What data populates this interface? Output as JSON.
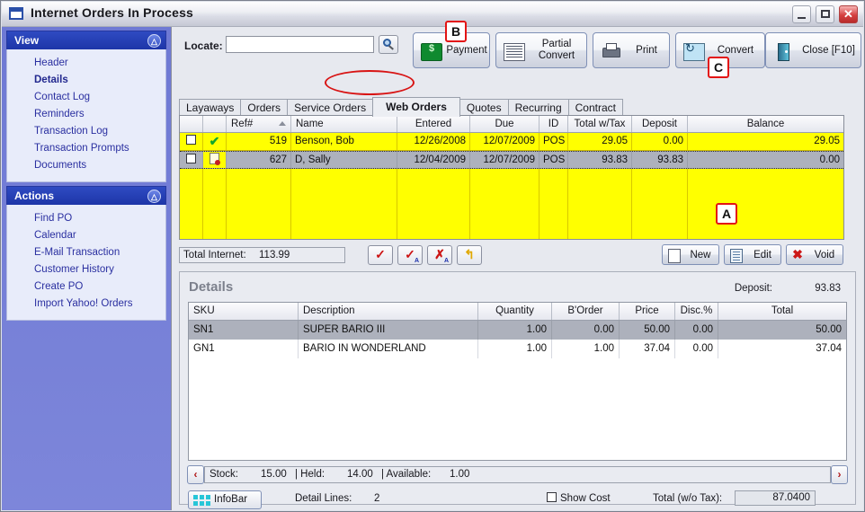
{
  "window": {
    "title": "Internet Orders In Process",
    "icon": "window-icon",
    "controls": {
      "minimize": "minimize-button",
      "maximize": "maximize-button",
      "close": "close-button"
    }
  },
  "sidebar": {
    "panels": [
      {
        "title": "View",
        "items": [
          {
            "label": "Header",
            "active": false
          },
          {
            "label": "Details",
            "active": true
          },
          {
            "label": "Contact Log",
            "active": false
          },
          {
            "label": "Reminders",
            "active": false
          },
          {
            "label": "Transaction Log",
            "active": false
          },
          {
            "label": "Transaction Prompts",
            "active": false
          },
          {
            "label": "Documents",
            "active": false
          }
        ]
      },
      {
        "title": "Actions",
        "items": [
          {
            "label": "Find PO",
            "active": false
          },
          {
            "label": "Calendar",
            "active": false
          },
          {
            "label": "E-Mail Transaction",
            "active": false
          },
          {
            "label": "Customer History",
            "active": false
          },
          {
            "label": "Create PO",
            "active": false
          },
          {
            "label": "Import Yahoo! Orders",
            "active": false
          }
        ]
      }
    ]
  },
  "toolbar": {
    "locate_label": "Locate:",
    "locate_value": "",
    "locate_placeholder": "",
    "search_icon": "search-icon",
    "buttons": [
      {
        "label": "Payment",
        "icon": "money-icon"
      },
      {
        "label_line1": "Partial",
        "label_line2": "Convert",
        "icon": "document-icon"
      },
      {
        "label": "Print",
        "icon": "printer-icon"
      },
      {
        "label": "Convert",
        "icon": "convert-icon"
      },
      {
        "label": "Close [F10]",
        "icon": "door-exit-icon"
      }
    ]
  },
  "tabs": [
    {
      "label": "Layaways",
      "selected": false
    },
    {
      "label": "Orders",
      "selected": false
    },
    {
      "label": "Service Orders",
      "selected": false
    },
    {
      "label": "Web Orders",
      "selected": true
    },
    {
      "label": "Quotes",
      "selected": false
    },
    {
      "label": "Recurring",
      "selected": false
    },
    {
      "label": "Contract",
      "selected": false
    }
  ],
  "orders_grid": {
    "columns": [
      "",
      "",
      "Ref#",
      "Name",
      "Entered",
      "Due",
      "ID",
      "Total w/Tax",
      "Deposit",
      "Balance"
    ],
    "sort_column": "Ref#",
    "rows": [
      {
        "checked": false,
        "status_icon": "green-check-icon",
        "ref": "519",
        "name": "Benson, Bob",
        "entered": "12/26/2008",
        "due": "12/07/2009",
        "id": "POS",
        "total_with_tax": "29.05",
        "deposit": "0.00",
        "balance": "29.05",
        "selected": false
      },
      {
        "checked": false,
        "status_icon": "page-alert-icon",
        "ref": "627",
        "name": "D, Sally",
        "entered": "12/04/2009",
        "due": "12/07/2009",
        "id": "POS",
        "total_with_tax": "93.83",
        "deposit": "93.83",
        "balance": "0.00",
        "selected": true
      }
    ]
  },
  "grid_footer": {
    "total_internet_label": "Total Internet:",
    "total_internet_value": "113.99",
    "icon_buttons": [
      {
        "name": "approve-icon",
        "glyph": "✓"
      },
      {
        "name": "approve-all-icon",
        "glyph": "✓"
      },
      {
        "name": "unapprove-all-icon",
        "glyph": "✗"
      },
      {
        "name": "undo-icon",
        "glyph": "↰"
      }
    ],
    "buttons": [
      {
        "label": "New",
        "icon": "new-document-icon"
      },
      {
        "label": "Edit",
        "icon": "edit-document-icon"
      },
      {
        "label": "Void",
        "icon": "red-x-icon"
      }
    ]
  },
  "details": {
    "title": "Details",
    "deposit_label": "Deposit:",
    "deposit_value": "93.83",
    "columns": [
      "SKU",
      "Description",
      "Quantity",
      "B'Order",
      "Price",
      "Disc.%",
      "Total"
    ],
    "rows": [
      {
        "sku": "SN1",
        "description": "SUPER BARIO III",
        "quantity": "1.00",
        "border": "0.00",
        "price": "50.00",
        "disc": "0.00",
        "total": "50.00",
        "selected": true
      },
      {
        "sku": "GN1",
        "description": "BARIO IN WONDERLAND",
        "quantity": "1.00",
        "border": "1.00",
        "price": "37.04",
        "disc": "0.00",
        "total": "37.04",
        "selected": false
      }
    ],
    "stock_bar": {
      "stock_label": "Stock:",
      "stock_value": "15.00",
      "sep1": "| Held:",
      "held_value": "14.00",
      "sep2": "| Available:",
      "available_value": "1.00"
    },
    "prev_arrow": "‹",
    "next_arrow": "›",
    "infobar_label": "InfoBar",
    "detail_lines_label": "Detail Lines:",
    "detail_lines_value": "2",
    "show_cost_label": "Show Cost",
    "show_cost_checked": false,
    "total_wo_tax_label": "Total (w/o Tax):",
    "total_wo_tax_value": "87.0400"
  },
  "annotations": [
    {
      "label": "A"
    },
    {
      "label": "B"
    },
    {
      "label": "C"
    }
  ],
  "colors": {
    "grid_highlight": "#ffff00",
    "row_selected": "#adb1bc",
    "sidebar_header": "#26389f",
    "annotation": "#e31414"
  }
}
